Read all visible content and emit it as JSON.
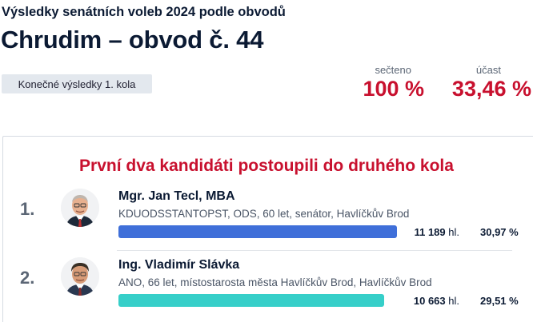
{
  "header": {
    "supertitle": "Výsledky senátních voleb 2024 podle obvodů",
    "title": "Chrudim – obvod č. 44",
    "round_badge": "Konečné výsledky 1. kola"
  },
  "stats": {
    "counted_label": "sečteno",
    "counted_value": "100 %",
    "turnout_label": "účast",
    "turnout_value": "33,46 %"
  },
  "panel": {
    "heading": "První dva kandidáti postoupili do druhého kola"
  },
  "candidates": [
    {
      "rank": "1.",
      "name": "Mgr. Jan Tecl, MBA",
      "meta": "KDUODSSTANTOPST, ODS, 60 let, senátor, Havlíčkův Brod",
      "votes_num": "11 189",
      "votes_unit": "hl.",
      "percent": "30,97 %",
      "share": 0.3097,
      "bar_color": "#3f6fd9"
    },
    {
      "rank": "2.",
      "name": "Ing. Vladimír Slávka",
      "meta": "ANO, 66 let, místostarosta města Havlíčkův Brod, Havlíčkův Brod",
      "votes_num": "10 663",
      "votes_unit": "hl.",
      "percent": "29,51 %",
      "share": 0.2951,
      "bar_color": "#36cfc9"
    }
  ],
  "colors": {
    "accent_red": "#c8102e",
    "text_dark": "#0b1a33"
  },
  "icons": {
    "candidate_1_photo": "candidate-portrait-icon",
    "candidate_2_photo": "candidate-portrait-icon"
  }
}
